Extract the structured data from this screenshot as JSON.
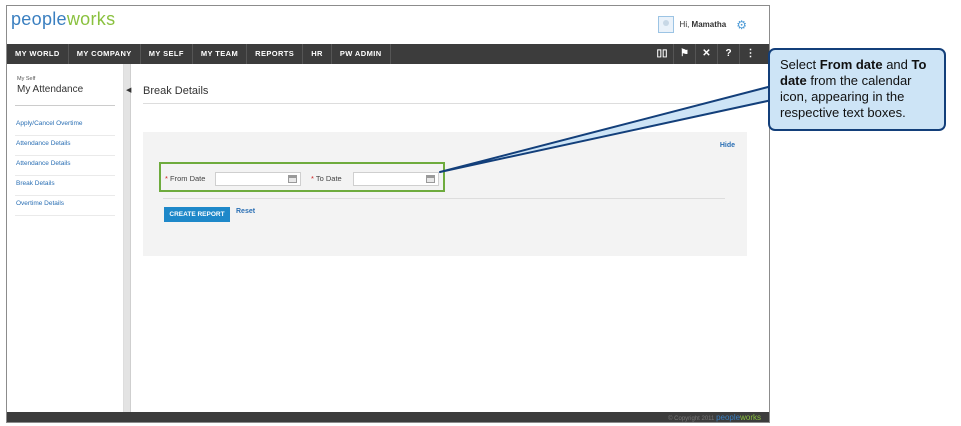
{
  "header": {
    "logo_part1": "pe",
    "logo_part2": "o",
    "logo_part3": "ple",
    "logo_part4": "works",
    "greeting_prefix": "Hi, ",
    "user_name": "Mamatha"
  },
  "nav": {
    "items": [
      "MY WORLD",
      "MY COMPANY",
      "MY SELF",
      "MY TEAM",
      "REPORTS",
      "HR",
      "PW ADMIN"
    ],
    "icons": [
      "book-icon",
      "flag-icon",
      "tools-icon",
      "help-icon",
      "sitemap-icon"
    ]
  },
  "sidebar": {
    "crumb": "My Self",
    "title": "My Attendance",
    "links": [
      "Apply/Cancel Overtime",
      "Attendance Details",
      "Attendance Details",
      "Break Details",
      "Overtime Details"
    ]
  },
  "main": {
    "title": "Break Details",
    "hide": "Hide",
    "from_label": "From Date",
    "to_label": "To Date",
    "required_mark": "*",
    "create_button": "CREATE REPORT",
    "reset": "Reset"
  },
  "footer": {
    "copyright": "© Copyright 2011 ",
    "brand_a": "people",
    "brand_b": "works"
  },
  "callout": {
    "t1": "Select ",
    "b1": "From date",
    "t2": " and ",
    "b2": "To date",
    "t3": " from the calendar icon, appearing in the respective text boxes."
  },
  "colors": {
    "nav_bg": "#3c3c3c",
    "link": "#2a6fb4",
    "button": "#1e88c9",
    "highlight_border": "#6eab3d",
    "callout_bg": "#cde4f6",
    "callout_border": "#133f7a"
  }
}
